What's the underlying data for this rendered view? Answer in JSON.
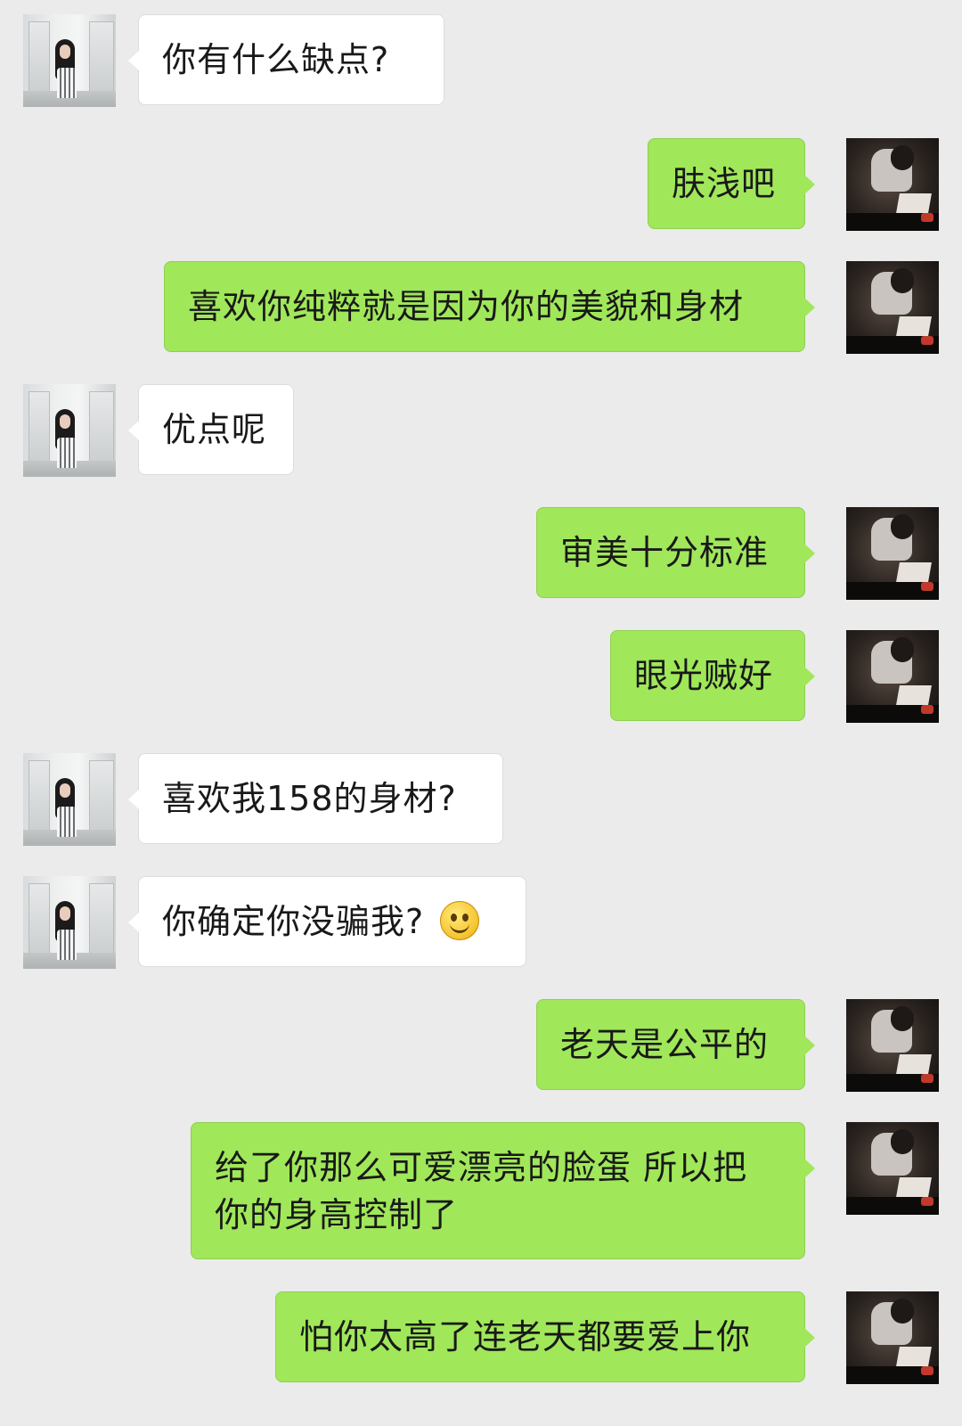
{
  "messages": [
    {
      "side": "left",
      "text": "你有什么缺点?",
      "avatar": "girl-avatar",
      "emoji": null
    },
    {
      "side": "right",
      "text": "肤浅吧",
      "avatar": "boy-avatar",
      "emoji": null
    },
    {
      "side": "right",
      "text": "喜欢你纯粹就是因为你的美貌和身材",
      "avatar": "boy-avatar",
      "emoji": null
    },
    {
      "side": "left",
      "text": "优点呢",
      "avatar": "girl-avatar",
      "emoji": null
    },
    {
      "side": "right",
      "text": "审美十分标准",
      "avatar": "boy-avatar",
      "emoji": null
    },
    {
      "side": "right",
      "text": "眼光贼好",
      "avatar": "boy-avatar",
      "emoji": null
    },
    {
      "side": "left",
      "text": "喜欢我158的身材?",
      "avatar": "girl-avatar",
      "emoji": null
    },
    {
      "side": "left",
      "text": "你确定你没骗我?",
      "avatar": "girl-avatar",
      "emoji": "smile-emoji"
    },
    {
      "side": "right",
      "text": "老天是公平的",
      "avatar": "boy-avatar",
      "emoji": null
    },
    {
      "side": "right",
      "text": "给了你那么可爱漂亮的脸蛋 所以把\n你的身高控制了",
      "avatar": "boy-avatar",
      "emoji": null
    },
    {
      "side": "right",
      "text": "怕你太高了连老天都要爱上你",
      "avatar": "boy-avatar",
      "emoji": null
    }
  ],
  "colors": {
    "background": "#ebebeb",
    "sent_bubble": "#a0e75a",
    "received_bubble": "#ffffff"
  }
}
